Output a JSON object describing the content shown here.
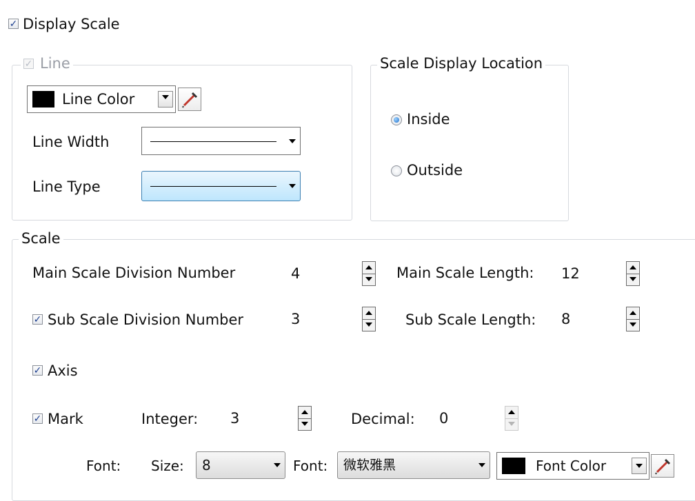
{
  "display_scale": {
    "label": "Display Scale",
    "checked": true
  },
  "line_group": {
    "legend": "Line",
    "checked": true,
    "enabled": false,
    "color_label": "Line Color",
    "color_value": "#000000",
    "width_label": "Line Width",
    "type_label": "Line Type"
  },
  "location_group": {
    "legend": "Scale Display Location",
    "inside_label": "Inside",
    "outside_label": "Outside",
    "selected": "Inside"
  },
  "scale_group": {
    "legend": "Scale",
    "main_div_label": "Main Scale Division Number",
    "main_div_value": "4",
    "main_len_label": "Main Scale Length:",
    "main_len_value": "12",
    "sub_div_label": "Sub Scale Division Number",
    "sub_div_checked": true,
    "sub_div_value": "3",
    "sub_len_label": "Sub Scale Length:",
    "sub_len_value": "8",
    "axis_label": "Axis",
    "axis_checked": true,
    "mark_label": "Mark",
    "mark_checked": true,
    "integer_label": "Integer:",
    "integer_value": "3",
    "decimal_label": "Decimal:",
    "decimal_value": "0",
    "font_row_label": "Font:",
    "size_label": "Size:",
    "size_value": "8",
    "font_label": "Font:",
    "font_value": "微软雅黑",
    "font_color_label": "Font Color",
    "font_color_value": "#000000"
  },
  "icons": {
    "check": "✓",
    "eyedropper": "eyedropper-icon",
    "dropdown": "chevron-down-icon",
    "spin_up": "arrow-up-icon",
    "spin_down": "arrow-down-icon"
  }
}
